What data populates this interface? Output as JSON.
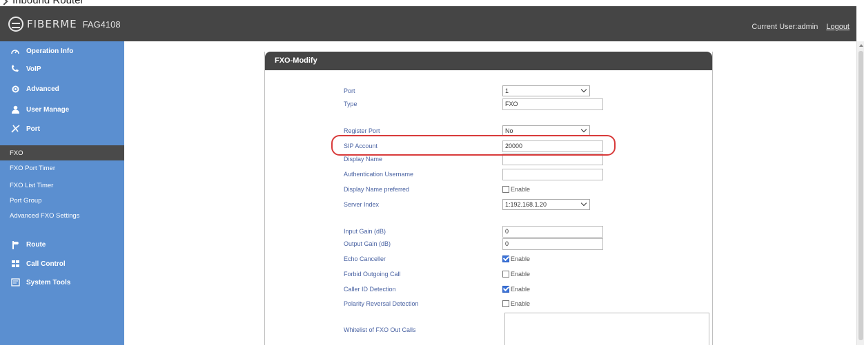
{
  "caption": "Inbound Router",
  "brand": {
    "logo_text": "FIBERME",
    "model": "FAG4108"
  },
  "header": {
    "current_user_label": "Current User:admin",
    "logout": "Logout"
  },
  "sidebar": {
    "items": [
      {
        "label": "Operation Info",
        "icon": "gauge-icon"
      },
      {
        "label": "VoIP",
        "icon": "phone-icon"
      },
      {
        "label": "Advanced",
        "icon": "gear-icon"
      },
      {
        "label": "User Manage",
        "icon": "user-icon"
      },
      {
        "label": "Port",
        "icon": "port-icon"
      }
    ],
    "sub_items": [
      {
        "label": "FXO",
        "active": true
      },
      {
        "label": "FXO Port Timer",
        "active": false
      },
      {
        "label": "FXO List Timer",
        "active": false
      },
      {
        "label": "Port Group",
        "active": false
      },
      {
        "label": "Advanced FXO Settings",
        "active": false
      }
    ],
    "items_bottom": [
      {
        "label": "Route",
        "icon": "route-icon"
      },
      {
        "label": "Call Control",
        "icon": "call-control-icon"
      },
      {
        "label": "System Tools",
        "icon": "tools-icon"
      }
    ]
  },
  "panel": {
    "title": "FXO-Modify",
    "fields": {
      "port": {
        "label": "Port",
        "value": "1"
      },
      "type": {
        "label": "Type",
        "value": "FXO"
      },
      "register_port": {
        "label": "Register Port",
        "value": "No"
      },
      "sip_account": {
        "label": "SIP Account",
        "value": "20000"
      },
      "display_name": {
        "label": "Display Name",
        "value": ""
      },
      "auth_username": {
        "label": "Authentication Username",
        "value": ""
      },
      "display_name_preferred": {
        "label": "Display Name preferred",
        "option": "Enable",
        "checked": false
      },
      "server_index": {
        "label": "Server Index",
        "value": "1:192.168.1.20"
      },
      "input_gain": {
        "label": "Input Gain (dB)",
        "value": "0"
      },
      "output_gain": {
        "label": "Output Gain (dB)",
        "value": "0"
      },
      "echo_canceller": {
        "label": "Echo Canceller",
        "option": "Enable",
        "checked": true
      },
      "forbid_outgoing": {
        "label": "Forbid Outgoing Call",
        "option": "Enable",
        "checked": false
      },
      "caller_id_detection": {
        "label": "Caller ID Detection",
        "option": "Enable",
        "checked": true
      },
      "polarity_reversal": {
        "label": "Polarity Reversal Detection",
        "option": "Enable",
        "checked": false
      },
      "whitelist": {
        "label": "Whitelist of FXO Out Calls",
        "value": ""
      }
    }
  },
  "colors": {
    "header": "#454545",
    "sidebar": "#5b8fd0",
    "label": "#4a63a3",
    "highlight": "#d83a3a",
    "checkbox": "#3b73d9"
  }
}
